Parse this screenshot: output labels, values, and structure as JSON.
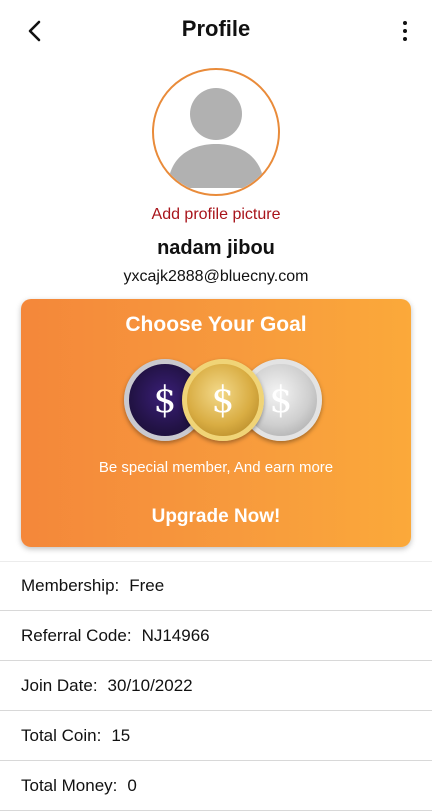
{
  "header": {
    "title": "Profile",
    "back_icon": "chevron-left-icon",
    "more_icon": "more-vertical-icon"
  },
  "profile": {
    "avatar_icon": "person-placeholder-icon",
    "add_picture_label": "Add profile picture",
    "name": "nadam jibou",
    "email": "yxcajk2888@bluecny.com"
  },
  "goal_card": {
    "title": "Choose Your Goal",
    "coins": [
      {
        "icon": "purple-dollar-coin-icon",
        "symbol": "$"
      },
      {
        "icon": "gold-dollar-coin-icon",
        "symbol": "$"
      },
      {
        "icon": "silver-dollar-coin-icon",
        "symbol": "$"
      }
    ],
    "subtitle": "Be special member, And earn more",
    "cta_label": "Upgrade Now!"
  },
  "info": [
    {
      "label": "Membership:",
      "value": "Free"
    },
    {
      "label": "Referral Code:",
      "value": "NJ14966"
    },
    {
      "label": "Join Date:",
      "value": "30/10/2022"
    },
    {
      "label": "Total Coin:",
      "value": "15"
    },
    {
      "label": "Total Money:",
      "value": "0"
    }
  ],
  "colors": {
    "accent_orange": "#f4873a",
    "add_picture_red": "#a8141b",
    "avatar_border": "#e98b3a"
  }
}
